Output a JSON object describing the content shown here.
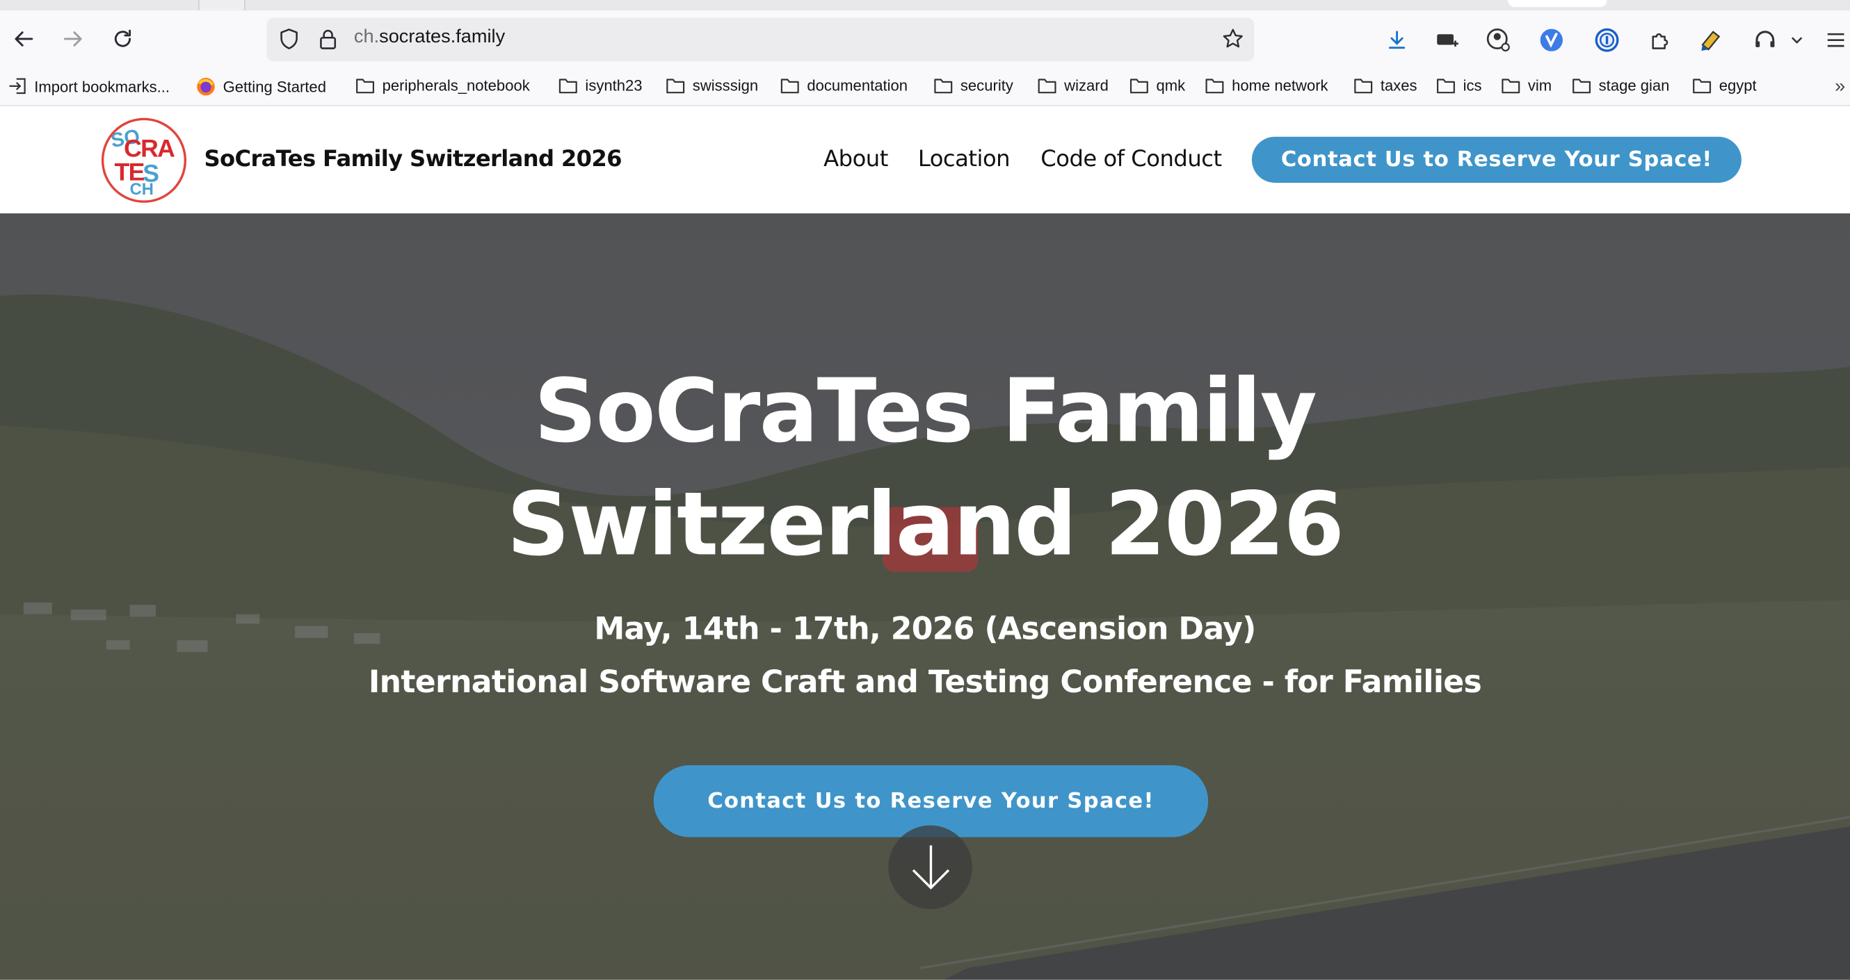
{
  "browser": {
    "url_prefix": "ch.",
    "url_domain": "socrates.family",
    "bookmarks": [
      {
        "label": "Import bookmarks...",
        "icon": "import-icon"
      },
      {
        "label": "Getting Started",
        "icon": "firefox-icon"
      },
      {
        "label": "peripherals_notebook",
        "icon": "folder-icon"
      },
      {
        "label": "isynth23",
        "icon": "folder-icon"
      },
      {
        "label": "swisssign",
        "icon": "folder-icon"
      },
      {
        "label": "documentation",
        "icon": "folder-icon"
      },
      {
        "label": "security",
        "icon": "folder-icon"
      },
      {
        "label": "wizard",
        "icon": "folder-icon"
      },
      {
        "label": "qmk",
        "icon": "folder-icon"
      },
      {
        "label": "home network",
        "icon": "folder-icon"
      },
      {
        "label": "taxes",
        "icon": "folder-icon"
      },
      {
        "label": "ics",
        "icon": "folder-icon"
      },
      {
        "label": "vim",
        "icon": "folder-icon"
      },
      {
        "label": "stage gian",
        "icon": "folder-icon"
      },
      {
        "label": "egypt",
        "icon": "folder-icon"
      }
    ],
    "overflow_chevron": "»"
  },
  "site": {
    "logo": {
      "l1": "SO",
      "l2": "CRA",
      "l3": "TE",
      "l4": "S",
      "l5": "CH"
    },
    "title": "SoCraTes Family Switzerland 2026",
    "nav": [
      "About",
      "Location",
      "Code of Conduct"
    ],
    "header_cta": "Contact Us to Reserve Your Space!"
  },
  "hero": {
    "title_line1": "SoCraTes Family",
    "title_line2": "Switzerland 2026",
    "date": "May, 14th - 17th, 2026 (Ascension Day)",
    "subtitle": "International Software Craft and Testing Conference - for Families",
    "cta": "Contact Us to Reserve Your Space!"
  },
  "colors": {
    "accent": "#3f95c9",
    "logo_red": "#d8282e",
    "logo_blue": "#4aa0cf"
  }
}
